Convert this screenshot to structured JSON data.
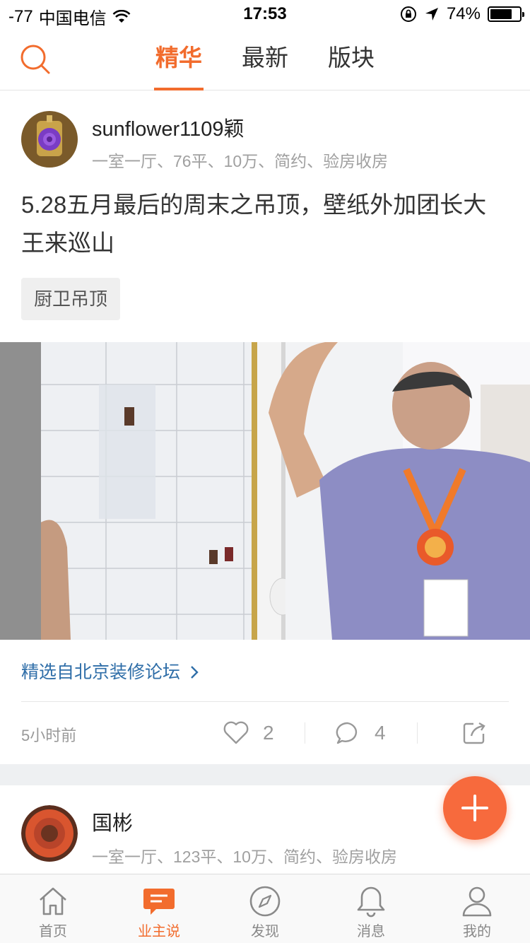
{
  "status_bar": {
    "signal": "-77",
    "carrier": "中国电信",
    "time": "17:53",
    "battery_percent": "74%",
    "battery_level": 0.74
  },
  "top_nav": {
    "search_icon": "search-icon",
    "tabs": [
      {
        "label": "精华",
        "active": true
      },
      {
        "label": "最新",
        "active": false
      },
      {
        "label": "版块",
        "active": false
      }
    ]
  },
  "post": {
    "author": "sunflower1109颖",
    "meta": "一室一厅、76平、10万、简约、验房收房",
    "title": "5.28五月最后的周末之吊顶，壁纸外加团长大王来巡山",
    "tag": "厨卫吊顶",
    "source": "精选自北京装修论坛",
    "time": "5小时前",
    "likes": "2",
    "comments": "4"
  },
  "post2": {
    "author": "国彬",
    "meta": "一室一厅、123平、10万、简约、验房收房"
  },
  "tab_bar": {
    "items": [
      {
        "label": "首页",
        "icon": "home-icon",
        "active": false
      },
      {
        "label": "业主说",
        "icon": "message-icon",
        "active": true
      },
      {
        "label": "发现",
        "icon": "compass-icon",
        "active": false
      },
      {
        "label": "消息",
        "icon": "bell-icon",
        "active": false
      },
      {
        "label": "我的",
        "icon": "user-icon",
        "active": false
      }
    ]
  },
  "colors": {
    "accent": "#f26c2d",
    "link": "#2f6ea8",
    "fab": "#f76a3d"
  }
}
